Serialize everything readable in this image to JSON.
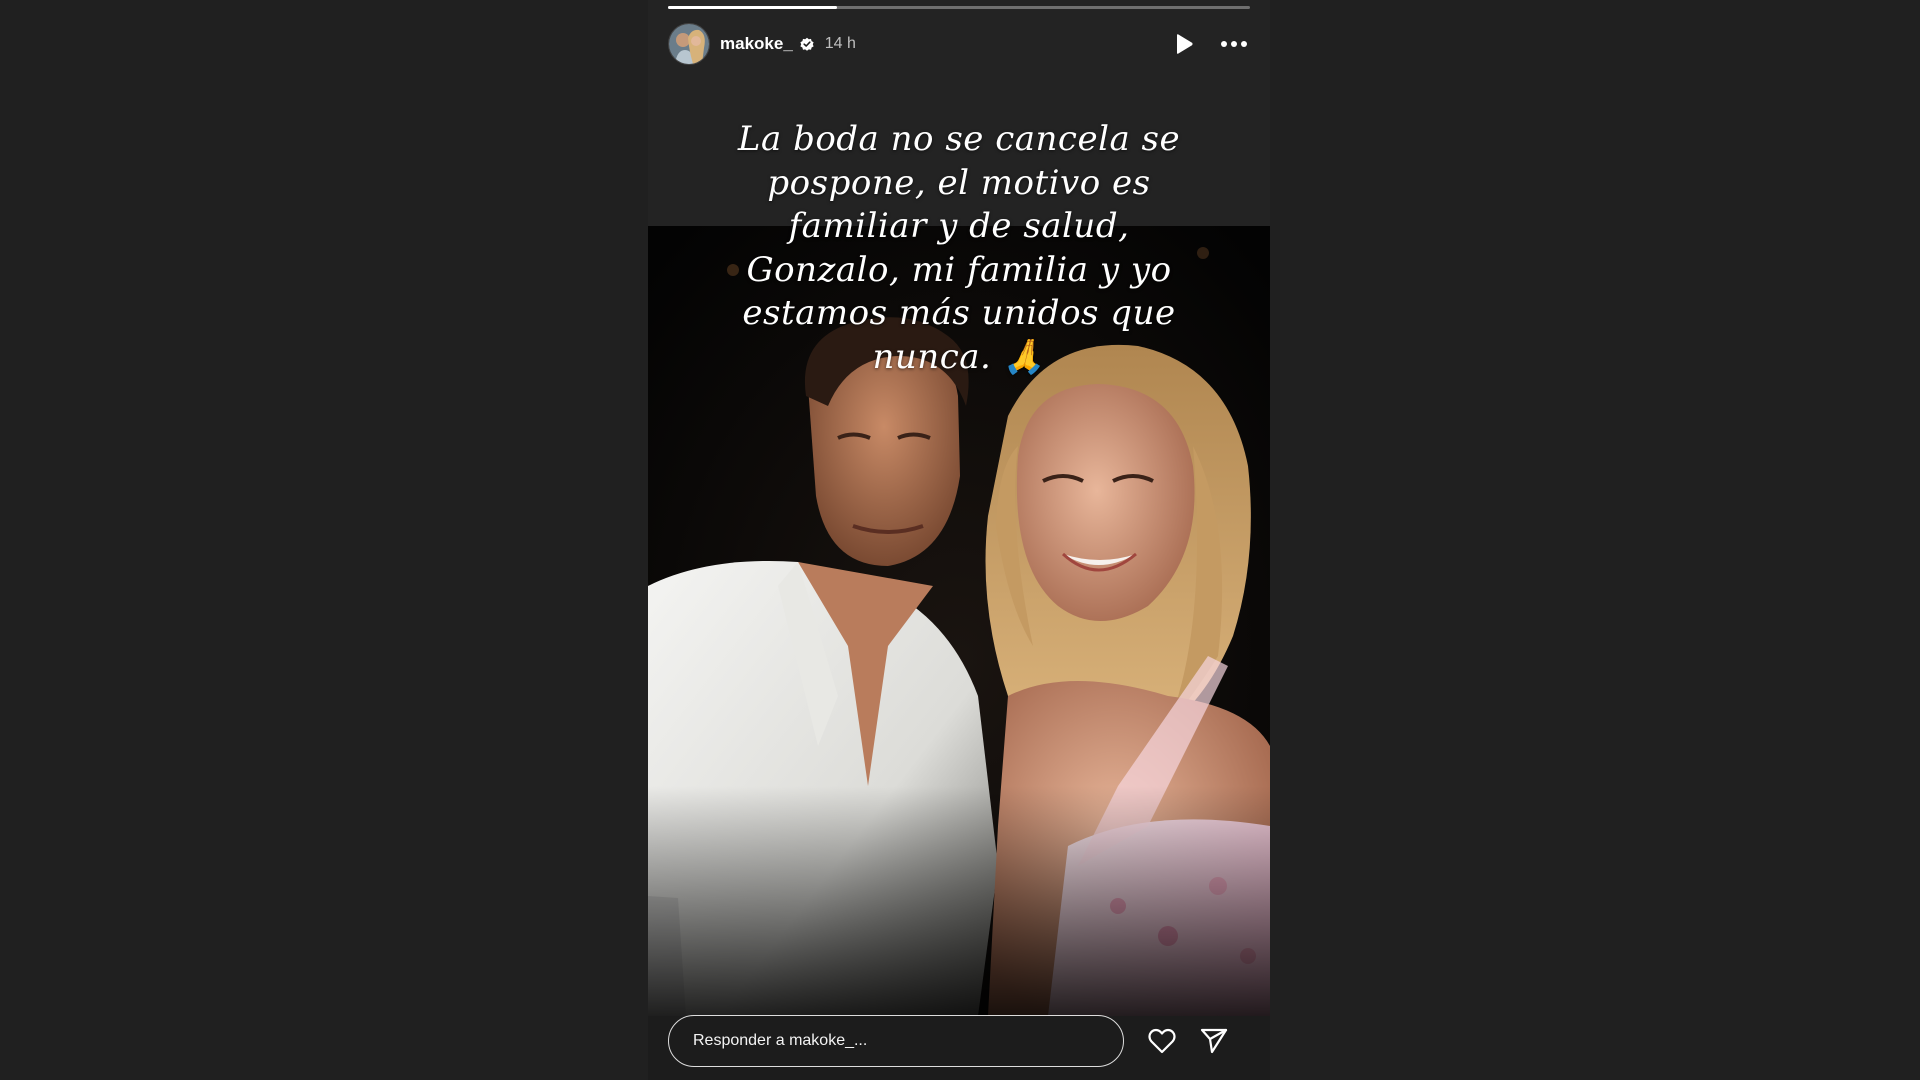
{
  "story": {
    "progress_fraction": 0.29,
    "user": {
      "username": "makoke_",
      "verified": true,
      "time_ago": "14 h",
      "avatar_icon": "avatar-photo"
    },
    "header_icons": {
      "play": "play-icon",
      "more": "more-horizontal-icon"
    },
    "caption": "La boda no se cancela se\npospone, el motivo es\nfamiliar y de salud,\nGonzalo, mi familia y yo\nestamos más unidos que\nnunca. 🙏",
    "media_description_icon": "couple-photo",
    "reply": {
      "placeholder": "Responder a makoke_..."
    },
    "footer_icons": {
      "like": "heart-icon",
      "share": "send-icon"
    }
  },
  "colors": {
    "page_background": "#202020",
    "story_background": "#1c1c1c",
    "text": "#ffffff",
    "verified_badge": "#ffffff"
  }
}
